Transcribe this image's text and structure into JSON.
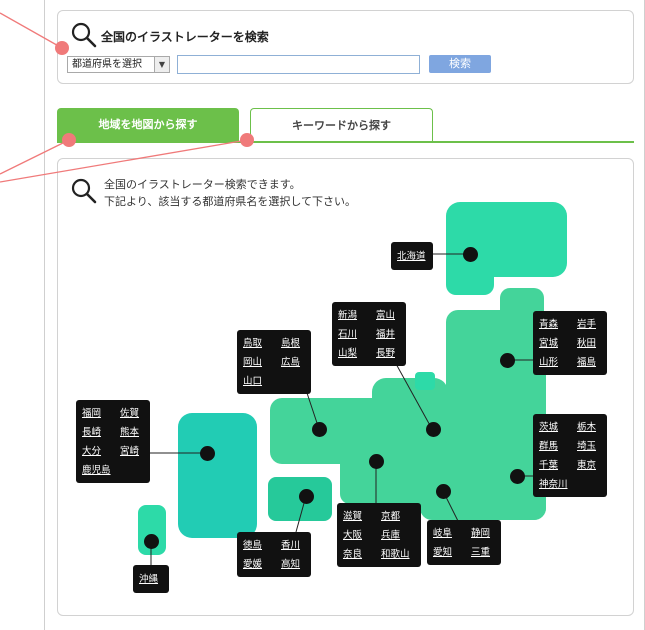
{
  "search": {
    "title": "全国のイラストレーターを検索",
    "select_value": "都道府県を選択",
    "button_label": "検索"
  },
  "tabs": {
    "map_label": "地域を地図から探す",
    "keyword_label": "キーワードから探す"
  },
  "intro": {
    "line1": "全国のイラストレーター検索できます。",
    "line2": "下記より、該当する都道府県名を選択して下さい。"
  },
  "regions": {
    "hokkaido": [
      "北海道"
    ],
    "tohoku": [
      "青森",
      "岩手",
      "宮城",
      "秋田",
      "山形",
      "福島"
    ],
    "kanto": [
      "茨城",
      "栃木",
      "群馬",
      "埼玉",
      "千葉",
      "東京",
      "神奈川"
    ],
    "chubu": [
      "新潟",
      "富山",
      "石川",
      "福井",
      "山梨",
      "長野"
    ],
    "tokai": [
      "岐阜",
      "静岡",
      "愛知",
      "三重"
    ],
    "kinki": [
      "滋賀",
      "京都",
      "大阪",
      "兵庫",
      "奈良",
      "和歌山"
    ],
    "chugoku": [
      "鳥取",
      "島根",
      "岡山",
      "広島",
      "山口"
    ],
    "shikoku": [
      "徳島",
      "香川",
      "愛媛",
      "高知"
    ],
    "kyushu": [
      "福岡",
      "佐賀",
      "長崎",
      "熊本",
      "大分",
      "宮崎",
      "鹿児島"
    ],
    "okinawa": [
      "沖縄"
    ]
  },
  "colors": {
    "tab_active": "#6cc04a",
    "button": "#7fa6e0",
    "annotation": "#f07a7a",
    "map_green": "#44d49a",
    "map_teal": "#2bc9b3"
  }
}
